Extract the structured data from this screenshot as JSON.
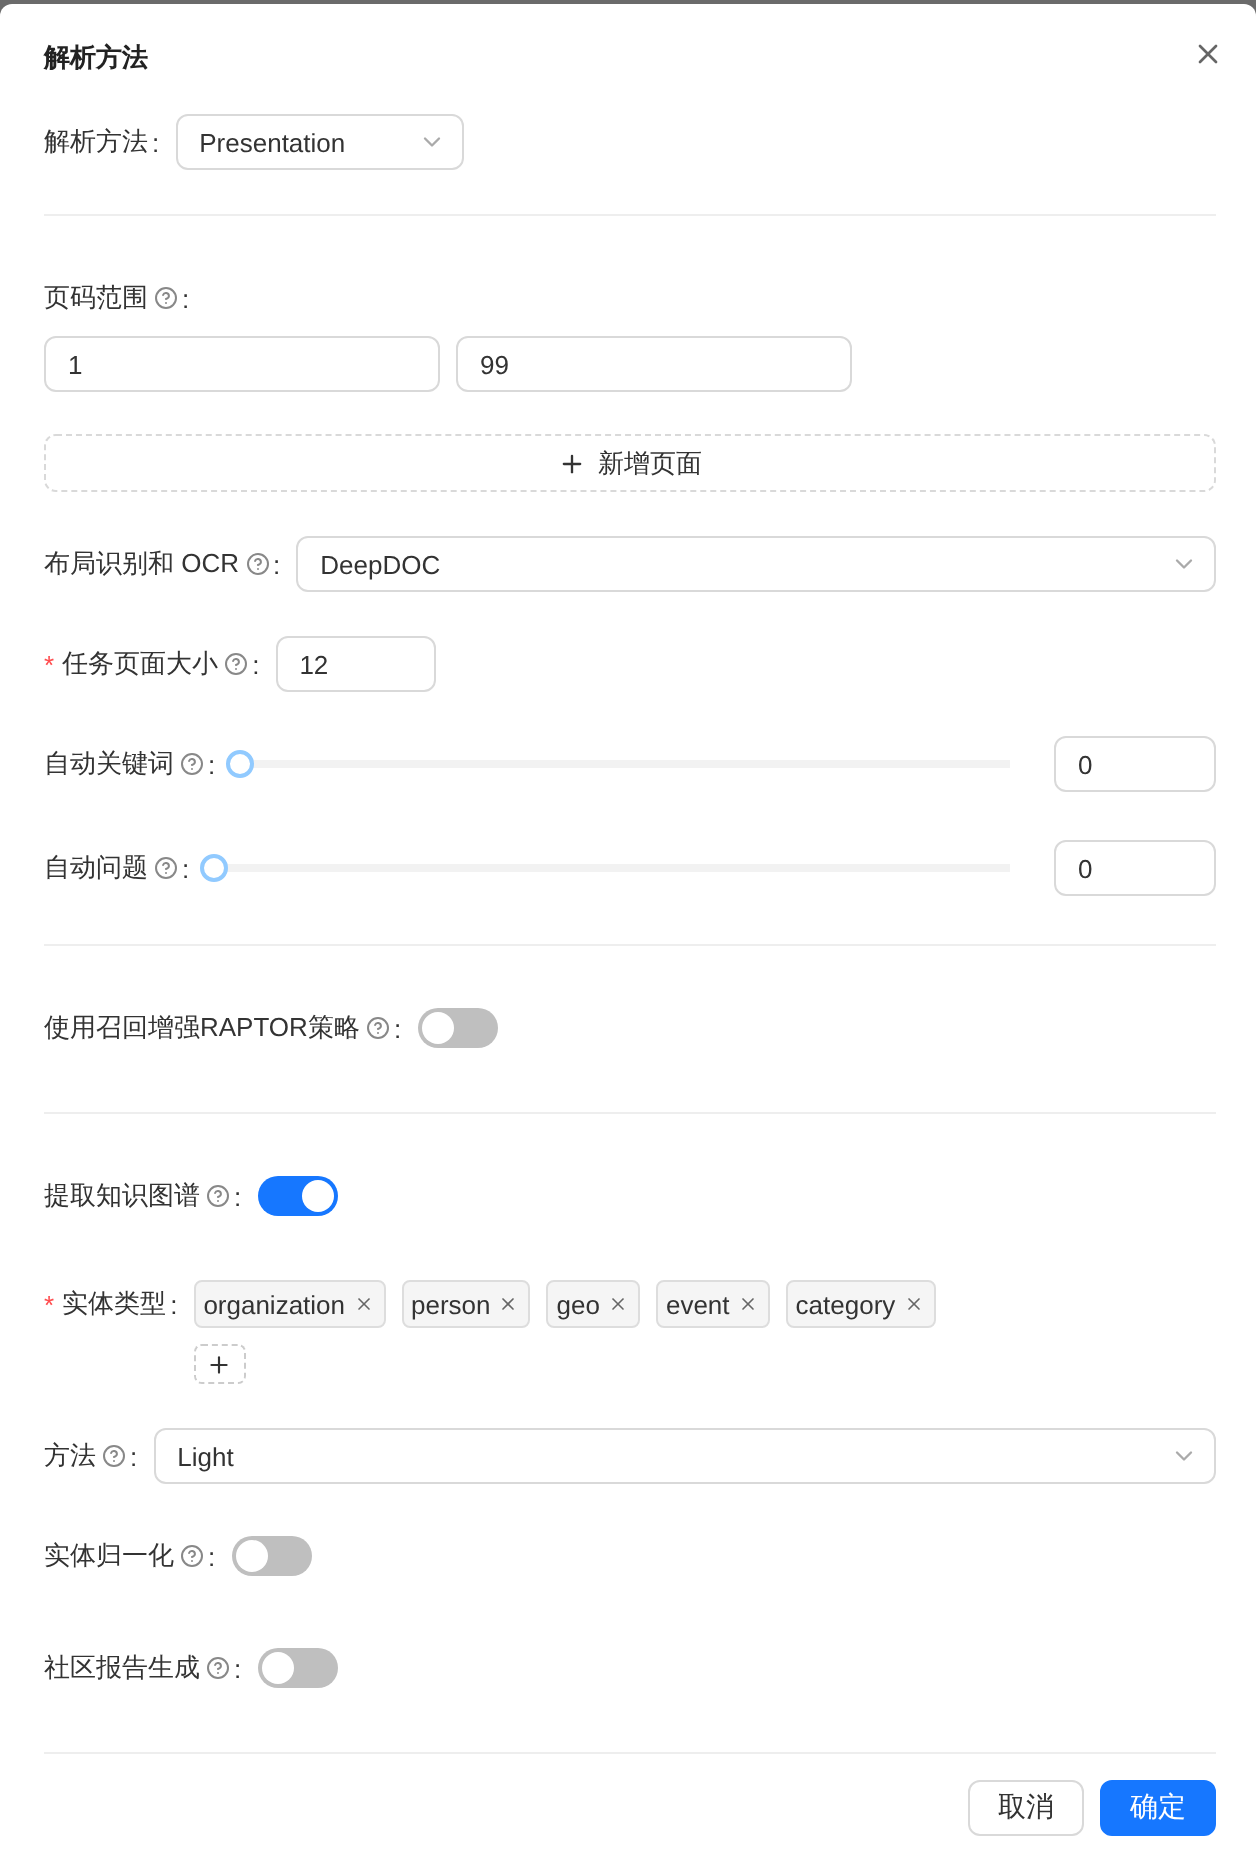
{
  "title": "解析方法",
  "sections": [
    {
      "fields": [
        {
          "kind": "select",
          "label": "解析方法",
          "suffix": ":",
          "help": false,
          "value": "Presentation",
          "wide": false
        }
      ]
    },
    {
      "fields": [
        {
          "kind": "range",
          "label": "页码范围",
          "suffix": ":",
          "help": true,
          "from": "1",
          "to": "99"
        },
        {
          "kind": "add",
          "text": "新增页面"
        },
        {
          "kind": "select",
          "label": "布局识别和 OCR",
          "suffix": ":",
          "help": true,
          "value": "DeepDOC",
          "wide": true
        },
        {
          "kind": "input",
          "label": "任务页面大小",
          "suffix": ":",
          "help": true,
          "required_mark": "*",
          "value": "12"
        },
        {
          "kind": "slider",
          "label": "自动关键词",
          "suffix": ":",
          "help": true,
          "level": 0,
          "value": "0"
        },
        {
          "kind": "slider",
          "label": "自动问题",
          "suffix": ":",
          "help": true,
          "level": 0,
          "value": "0"
        }
      ]
    },
    {
      "fields": [
        {
          "kind": "switch",
          "label": "使用召回增强RAPTOR策略",
          "suffix": ":",
          "help": true,
          "on": false
        }
      ]
    },
    {
      "fields": [
        {
          "kind": "switch",
          "label": "提取知识图谱",
          "suffix": ":",
          "help": true,
          "on": true
        },
        {
          "kind": "tags",
          "label": "实体类型",
          "suffix": ":",
          "help": false,
          "required_mark": "*",
          "tags": [
            "organization",
            "person",
            "geo",
            "event",
            "category"
          ]
        },
        {
          "kind": "select",
          "label": "方法",
          "suffix": ":",
          "help": true,
          "value": "Light",
          "wide": true
        },
        {
          "kind": "switch",
          "label": "实体归一化",
          "suffix": ":",
          "help": true,
          "on": false
        },
        {
          "kind": "switch",
          "label": "社区报告生成",
          "suffix": ":",
          "help": true,
          "on": false
        }
      ]
    }
  ],
  "buttons": [
    {
      "label": "取消",
      "primary": false
    },
    {
      "label": "确定",
      "primary": true
    }
  ]
}
